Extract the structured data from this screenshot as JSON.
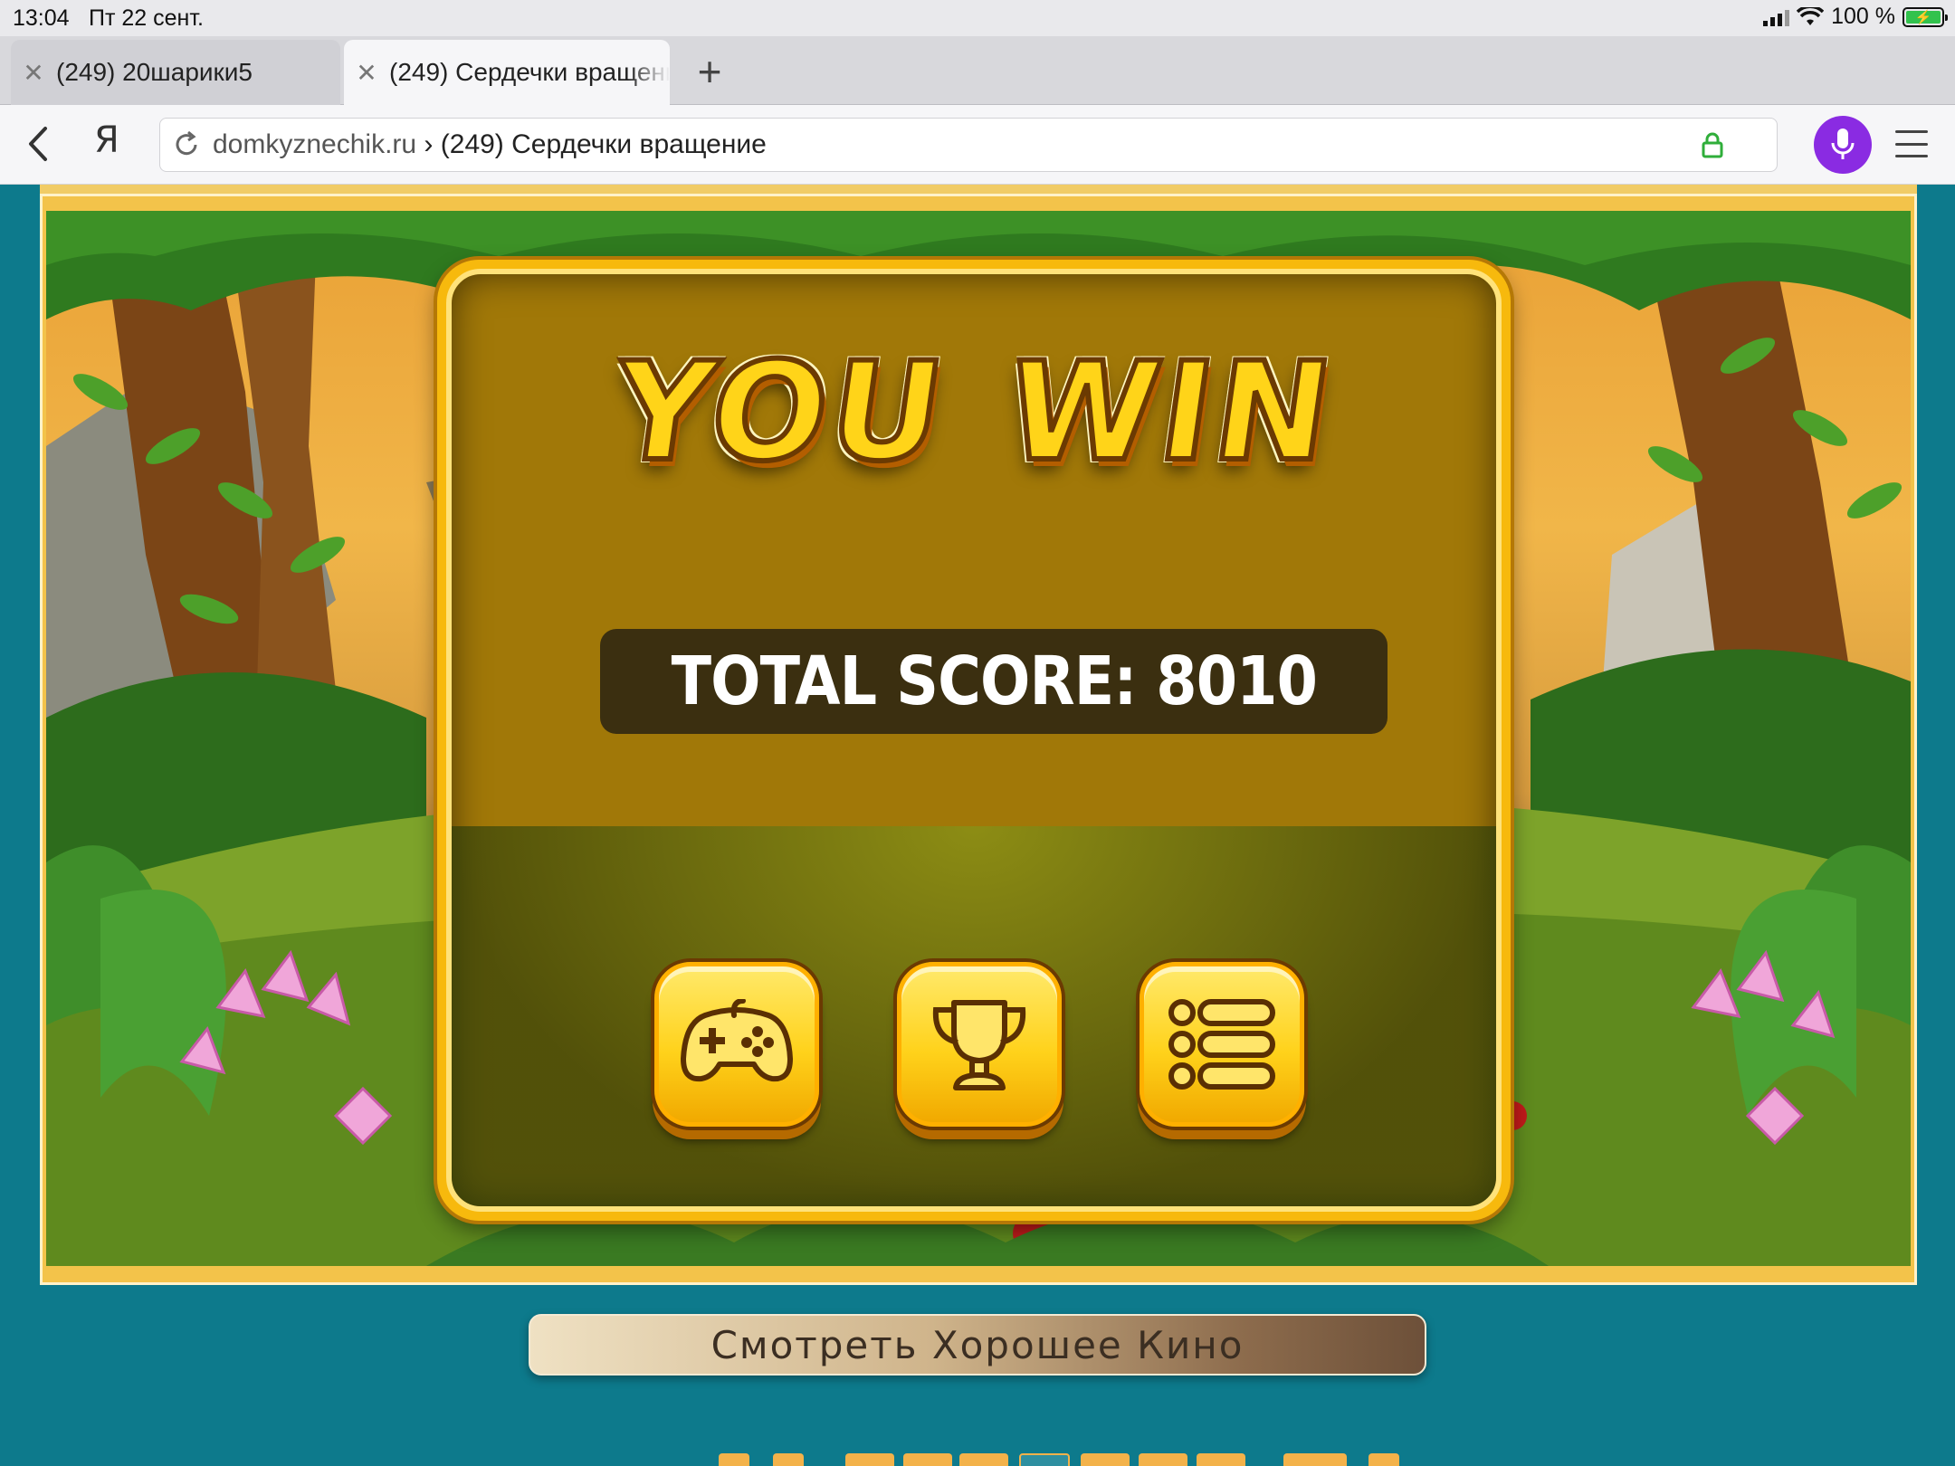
{
  "status_bar": {
    "time": "13:04",
    "date": "Пт 22 сент.",
    "battery": "100 %"
  },
  "tabs": [
    {
      "label": "(249) 20шарики5",
      "active": false
    },
    {
      "label": "(249) Сердечки вращение",
      "active": true
    }
  ],
  "browser": {
    "ya_label": "Я",
    "url_domain": "domkyznechik.ru",
    "url_separator": " › ",
    "url_title": "(249) Сердечки вращение",
    "accent": "#8a2be2"
  },
  "game": {
    "title_word1": "YOU",
    "title_word2": "WIN",
    "score_text": "TOTAL SCORE: 8010",
    "buttons": [
      {
        "icon": "gamepad-icon"
      },
      {
        "icon": "trophy-icon"
      },
      {
        "icon": "list-menu-icon"
      }
    ]
  },
  "page": {
    "movie_button_label": "Смотреть Хорошее Кино"
  }
}
